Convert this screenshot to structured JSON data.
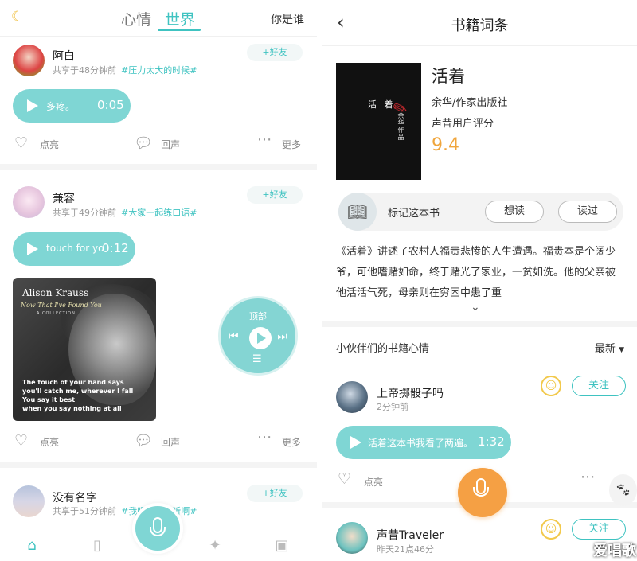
{
  "left": {
    "header": {
      "tab_mood": "心情",
      "tab_world": "世界",
      "who": "你是谁"
    },
    "posts": [
      {
        "user": "阿白",
        "time": "共享于48分钟前",
        "tag": "#压力太大的时候#",
        "add_friend": "+好友",
        "voice_text": "多疼。",
        "voice_duration": "0:05",
        "like": "点亮",
        "echo": "回声",
        "more": "更多"
      },
      {
        "user": "兼容",
        "time": "共享于49分钟前",
        "tag": "#大家一起练口语#",
        "add_friend": "+好友",
        "voice_text": "touch for yo",
        "voice_duration": "0:12",
        "like": "点亮",
        "echo": "回声",
        "more": "更多",
        "album": {
          "artist": "Alison Krauss",
          "title": "Now That I've Found You",
          "subtitle": "A COLLECTION",
          "lyrics": [
            "The touch of your hand says",
            "you'll catch me, wherever I fall",
            "You say it best",
            "when you say nothing at all"
          ]
        }
      },
      {
        "user": "没有名字",
        "time": "共享于51分钟前",
        "tag": "#我唱歌给你听啊#",
        "add_friend": "+好友"
      }
    ],
    "player": {
      "top_label": "顶部"
    }
  },
  "right": {
    "header": {
      "title": "书籍词条"
    },
    "book": {
      "title": "活着",
      "publisher": "余华/作家出版社",
      "score_label": "声昔用户评分",
      "score": "9.4",
      "cover_title": "活 着",
      "cover_author": "余华作品"
    },
    "mark": {
      "label": "标记这本书",
      "want": "想读",
      "read": "读过"
    },
    "description": "《活着》讲述了农村人福贵悲惨的人生遭遇。福贵本是个阔少爷，可他嗜赌如命，终于赌光了家业，一贫如洗。他的父亲被他活活气死，母亲则在穷困中患了重",
    "section": {
      "title": "小伙伴们的书籍心情",
      "sort": "最新"
    },
    "comments": [
      {
        "user": "上帝掷骰子吗",
        "time": "2分钟前",
        "follow": "关注",
        "voice_text": "活着这本书我看了两遍。",
        "voice_duration": "1:32",
        "like": "点亮"
      },
      {
        "user": "声昔Traveler",
        "time": "昨天21点46分",
        "follow": "关注"
      }
    ],
    "watermark": "爱唱歌"
  },
  "colors": {
    "accent": "#3fc3c1",
    "voice": "#7fd6d4",
    "score": "#f0a53b",
    "mic_orange": "#f5a044"
  }
}
